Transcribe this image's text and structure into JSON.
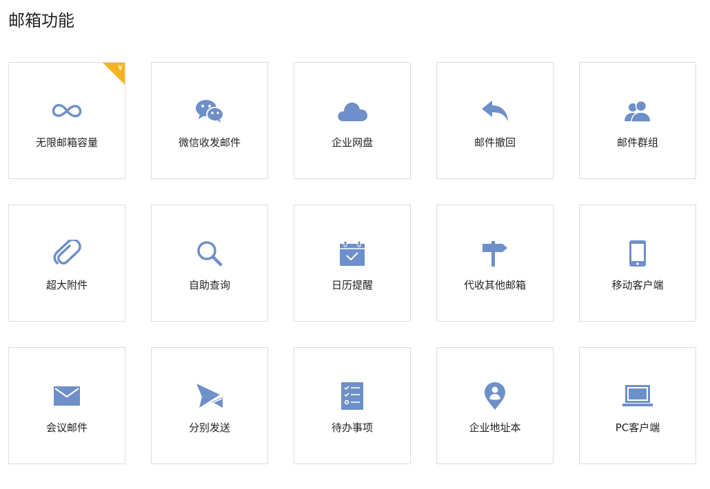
{
  "page": {
    "title": "邮箱功能"
  },
  "colors": {
    "icon": "#6e8fc9",
    "badge": "#f5b324",
    "border": "#dcdcdc"
  },
  "features": [
    {
      "label": "无限邮箱容量",
      "icon": "infinity-icon",
      "badge": "¥"
    },
    {
      "label": "微信收发邮件",
      "icon": "wechat-icon"
    },
    {
      "label": "企业网盘",
      "icon": "cloud-icon"
    },
    {
      "label": "邮件撤回",
      "icon": "reply-arrow-icon"
    },
    {
      "label": "邮件群组",
      "icon": "user-group-icon"
    },
    {
      "label": "超大附件",
      "icon": "paperclip-icon"
    },
    {
      "label": "自助查询",
      "icon": "search-icon"
    },
    {
      "label": "日历提醒",
      "icon": "calendar-icon"
    },
    {
      "label": "代收其他邮箱",
      "icon": "signpost-icon"
    },
    {
      "label": "移动客户端",
      "icon": "mobile-phone-icon"
    },
    {
      "label": "会议邮件",
      "icon": "envelope-icon"
    },
    {
      "label": "分别发送",
      "icon": "paper-plane-icon"
    },
    {
      "label": "待办事项",
      "icon": "todo-list-icon"
    },
    {
      "label": "企业地址本",
      "icon": "location-pin-icon"
    },
    {
      "label": "PC客户端",
      "icon": "laptop-icon"
    }
  ]
}
